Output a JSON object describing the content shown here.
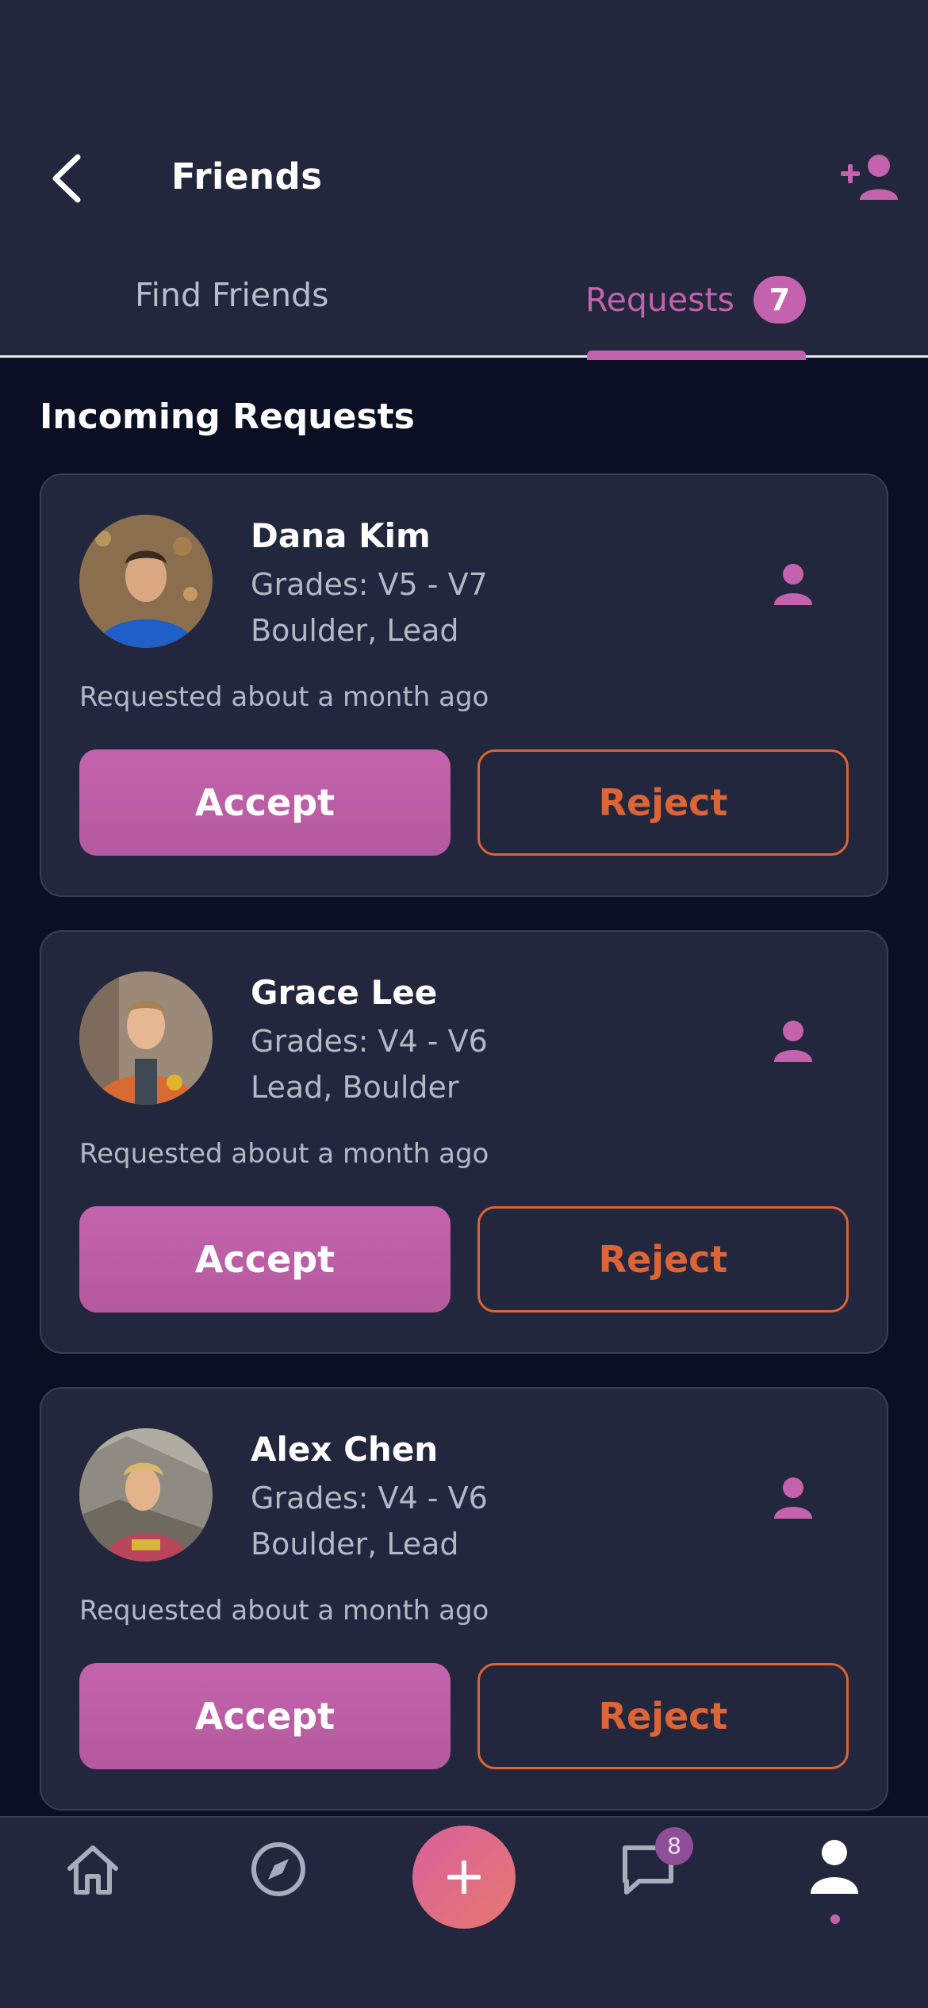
{
  "header": {
    "title": "Friends",
    "back_icon": "chevron-left-icon",
    "add_friend_icon": "person-add-icon"
  },
  "tabs": [
    {
      "label": "Find Friends",
      "active": false
    },
    {
      "label": "Requests",
      "active": true,
      "badge": "7"
    }
  ],
  "section": {
    "title": "Incoming Requests"
  },
  "requests": [
    {
      "name": "Dana Kim",
      "grades": "Grades: V5 - V7",
      "styles": "Boulder, Lead",
      "requested": "Requested about a month ago",
      "accept_label": "Accept",
      "reject_label": "Reject"
    },
    {
      "name": "Grace Lee",
      "grades": "Grades: V4 - V6",
      "styles": "Lead, Boulder",
      "requested": "Requested about a month ago",
      "accept_label": "Accept",
      "reject_label": "Reject"
    },
    {
      "name": "Alex Chen",
      "grades": "Grades: V4 - V6",
      "styles": "Boulder, Lead",
      "requested": "Requested about a month ago",
      "accept_label": "Accept",
      "reject_label": "Reject"
    }
  ],
  "bottom_nav": {
    "items": [
      "home-icon",
      "compass-icon",
      "plus-icon",
      "chat-icon",
      "profile-icon"
    ],
    "chat_badge": "8",
    "active": "profile"
  },
  "colors": {
    "accent": "#c462ad",
    "reject": "#dd6436",
    "background": "#0b0f23",
    "surface": "#23273d"
  }
}
